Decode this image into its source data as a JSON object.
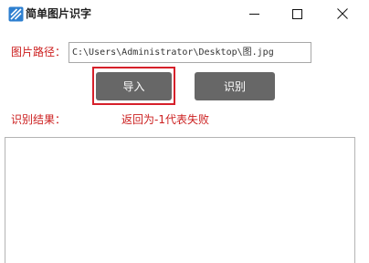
{
  "window": {
    "title": "简单图片识字",
    "icon": "app-stripes-icon",
    "controls": {
      "minimize_icon": "minimize-icon",
      "maximize_icon": "maximize-icon",
      "close_icon": "close-icon"
    }
  },
  "form": {
    "path_label": "图片路径：",
    "path_value": "C:\\Users\\Administrator\\Desktop\\图.jpg",
    "import_button": "导入",
    "recognize_button": "识别",
    "result_label": "识别结果：",
    "result_status": "返回为-1代表失败",
    "result_text": ""
  },
  "colors": {
    "label_red": "#cc1f1f",
    "button_gray": "#676767",
    "focus_red": "#d6202a",
    "icon_blue": "#2d7fd0"
  }
}
